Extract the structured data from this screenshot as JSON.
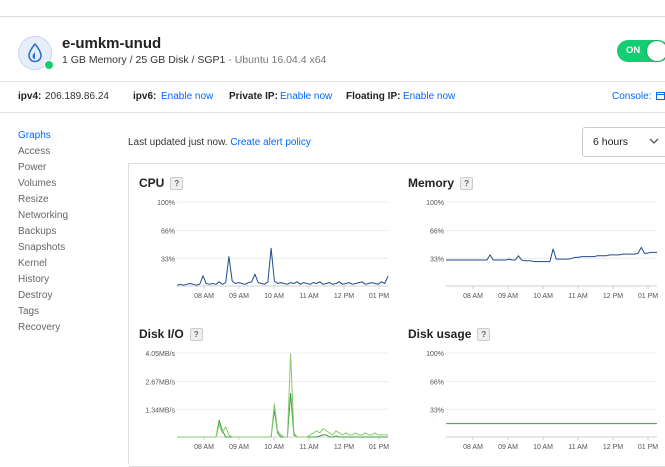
{
  "header": {
    "name": "e-umkm-unud",
    "spec": "1 GB Memory / 25 GB Disk / SGP1",
    "os": " - Ubuntu 16.04.4 x64",
    "power_label": "ON"
  },
  "network": {
    "ipv4_label": "ipv4:",
    "ipv4_value": "206.189.86.24",
    "ipv6_label": "ipv6:",
    "ipv6_link": "Enable now",
    "private_ip_label": "Private IP:",
    "private_ip_link": "Enable now",
    "floating_ip_label": "Floating IP:",
    "floating_ip_link": "Enable now",
    "console_label": "Console:"
  },
  "sidebar": {
    "items": [
      {
        "label": "Graphs",
        "active": true
      },
      {
        "label": "Access"
      },
      {
        "label": "Power"
      },
      {
        "label": "Volumes"
      },
      {
        "label": "Resize"
      },
      {
        "label": "Networking"
      },
      {
        "label": "Backups"
      },
      {
        "label": "Snapshots"
      },
      {
        "label": "Kernel"
      },
      {
        "label": "History"
      },
      {
        "label": "Destroy"
      },
      {
        "label": "Tags"
      },
      {
        "label": "Recovery"
      }
    ]
  },
  "graphs": {
    "updated_text": "Last updated just now.",
    "alert_link": "Create alert policy",
    "range_value": "6 hours",
    "help_label": "?"
  },
  "chart_data": [
    {
      "type": "line",
      "title": "CPU",
      "x": [
        "08 AM",
        "09 AM",
        "10 AM",
        "11 AM",
        "12 PM",
        "01 PM"
      ],
      "yticks": [
        "100%",
        "66%",
        "33%"
      ],
      "ylim": [
        0,
        100
      ],
      "color": "#1e4b8f",
      "fill": false,
      "series": [
        {
          "values": [
            1,
            2,
            1,
            2,
            3,
            2,
            1,
            2,
            12,
            3,
            2,
            3,
            2,
            5,
            2,
            4,
            35,
            6,
            3,
            4,
            3,
            2,
            4,
            5,
            14,
            4,
            3,
            2,
            5,
            45,
            6,
            3,
            4,
            3,
            2,
            4,
            3,
            5,
            2,
            4,
            3,
            2,
            4,
            3,
            5,
            2,
            3,
            4,
            2,
            3,
            5,
            2,
            3,
            4,
            2,
            3,
            4,
            5,
            2,
            3,
            4,
            3,
            2,
            5,
            3,
            12
          ]
        }
      ]
    },
    {
      "type": "line",
      "title": "Memory",
      "x": [
        "08 AM",
        "09 AM",
        "10 AM",
        "11 AM",
        "12 PM",
        "01 PM"
      ],
      "yticks": [
        "100%",
        "66%",
        "33%"
      ],
      "ylim": [
        0,
        100
      ],
      "color": "#1e4b8f",
      "fill": false,
      "series": [
        {
          "values": [
            31,
            31,
            31,
            31,
            31,
            31,
            31,
            31,
            31,
            31,
            31,
            31,
            31,
            31,
            37,
            31,
            31,
            31,
            31,
            31,
            32,
            31,
            31,
            36,
            31,
            30,
            30,
            30,
            29,
            29,
            29,
            29,
            29,
            29,
            44,
            32,
            32,
            32,
            32,
            32,
            33,
            34,
            34,
            35,
            35,
            35,
            35,
            35,
            36,
            36,
            36,
            36,
            37,
            37,
            37,
            37,
            38,
            38,
            38,
            38,
            38,
            39,
            46,
            39,
            39,
            40,
            40,
            40
          ]
        }
      ]
    },
    {
      "type": "line",
      "title": "Disk I/O",
      "x": [
        "08 AM",
        "09 AM",
        "10 AM",
        "11 AM",
        "12 PM",
        "01 PM"
      ],
      "yticks": [
        "4.05MB/s",
        "2.67MB/s",
        "1.34MB/s"
      ],
      "ylim": [
        0,
        4.05
      ],
      "color": "#3aa040",
      "color2": "#8bc86f",
      "fill": false,
      "series": [
        {
          "values": [
            0,
            0,
            0,
            0,
            0,
            0,
            0,
            0,
            0,
            0,
            0,
            0,
            0,
            0.8,
            0.3,
            0,
            0,
            0,
            0,
            0,
            0,
            0,
            0,
            0,
            0,
            0,
            0,
            0,
            0,
            0,
            1.3,
            0.2,
            0,
            0,
            0,
            2.1,
            0.1,
            0,
            0,
            0,
            0,
            0,
            0,
            0,
            0.05,
            0.1,
            0.1,
            0,
            0,
            0.05,
            0,
            0,
            0,
            0,
            0,
            0,
            0,
            0,
            0,
            0,
            0,
            0,
            0,
            0,
            0,
            0
          ]
        },
        {
          "values": [
            0,
            0,
            0,
            0,
            0,
            0,
            0,
            0,
            0,
            0,
            0,
            0,
            0,
            0.6,
            0.2,
            0.5,
            0.1,
            0,
            0,
            0,
            0,
            0,
            0,
            0,
            0,
            0,
            0,
            0,
            0,
            0,
            1.6,
            0.3,
            0.1,
            0,
            0,
            4.0,
            0.2,
            0,
            0,
            0,
            0,
            0.1,
            0.2,
            0.3,
            0.2,
            0.4,
            0.3,
            0.2,
            0.1,
            0.3,
            0.2,
            0.1,
            0.2,
            0.1,
            0.1,
            0.2,
            0.1,
            0.1,
            0.2,
            0.1,
            0.1,
            0.2,
            0.1,
            0.1,
            0.1,
            0.1
          ]
        }
      ]
    },
    {
      "type": "line",
      "title": "Disk usage",
      "x": [
        "08 AM",
        "09 AM",
        "10 AM",
        "11 AM",
        "12 PM",
        "01 PM"
      ],
      "yticks": [
        "100%",
        "66%",
        "33%"
      ],
      "ylim": [
        0,
        100
      ],
      "color": "#3aa040",
      "fill": false,
      "series": [
        {
          "values": [
            16,
            16,
            16,
            16,
            16,
            16,
            16,
            16,
            16,
            16,
            16,
            16,
            16,
            16,
            16,
            16,
            16,
            16,
            16,
            16,
            16,
            16,
            16,
            16,
            16,
            16,
            16,
            16,
            16,
            16,
            16,
            16,
            16,
            16,
            16,
            16,
            16,
            16,
            16,
            16,
            16,
            16,
            16,
            16,
            16,
            16,
            16,
            16,
            16,
            16,
            16,
            16,
            16,
            16,
            16,
            16,
            16,
            16,
            16,
            16,
            16,
            16,
            16,
            16,
            16,
            16,
            16,
            16,
            16,
            16
          ]
        }
      ]
    }
  ]
}
